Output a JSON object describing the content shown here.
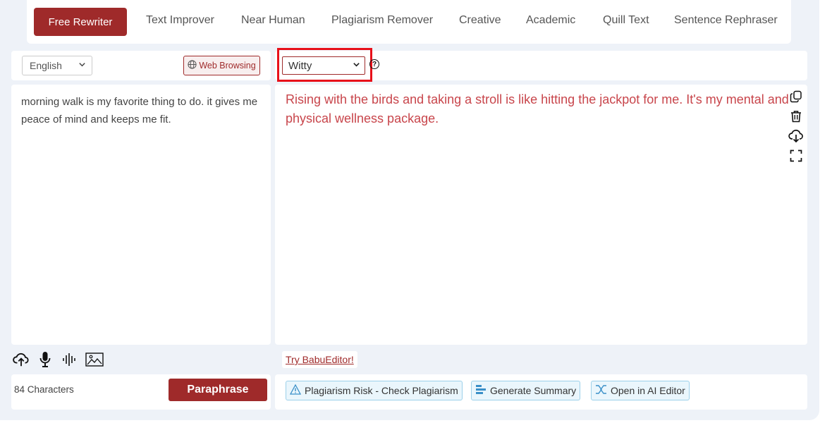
{
  "tabs": [
    {
      "label": "Free Rewriter",
      "active": true
    },
    {
      "label": "Text Improver"
    },
    {
      "label": "Near Human"
    },
    {
      "label": "Plagiarism Remover"
    },
    {
      "label": "Creative"
    },
    {
      "label": "Academic"
    },
    {
      "label": "Quill Text"
    },
    {
      "label": "Sentence Rephraser"
    }
  ],
  "input": {
    "language": "English",
    "web_browsing_label": "Web Browsing",
    "text": "morning walk is my favorite thing to do. it gives me peace of mind and keeps me fit.",
    "char_count": "84 Characters",
    "paraphrase_label": "Paraphrase",
    "tools": [
      "upload-icon",
      "microphone-icon",
      "audio-wave-icon",
      "image-icon"
    ]
  },
  "output": {
    "mode": "Witty",
    "help_glyph": "?",
    "text": "Rising with the birds and taking a stroll is like hitting the jackpot for me. It's my mental and physical wellness package.",
    "side_icons": [
      "copy-icon",
      "trash-icon",
      "download-icon",
      "fullscreen-icon"
    ],
    "try_link": "Try BabuEditor!",
    "actions": [
      {
        "label": "Plagiarism Risk - Check Plagiarism",
        "icon": "warning-icon"
      },
      {
        "label": "Generate Summary",
        "icon": "summary-icon"
      },
      {
        "label": "Open in AI Editor",
        "icon": "ai-editor-icon"
      }
    ]
  },
  "colors": {
    "brand": "#9f2a2a",
    "output_text": "#c8454b",
    "highlight": "#e8101a",
    "action_border": "#9cd0ea",
    "background": "#eef2f8"
  }
}
